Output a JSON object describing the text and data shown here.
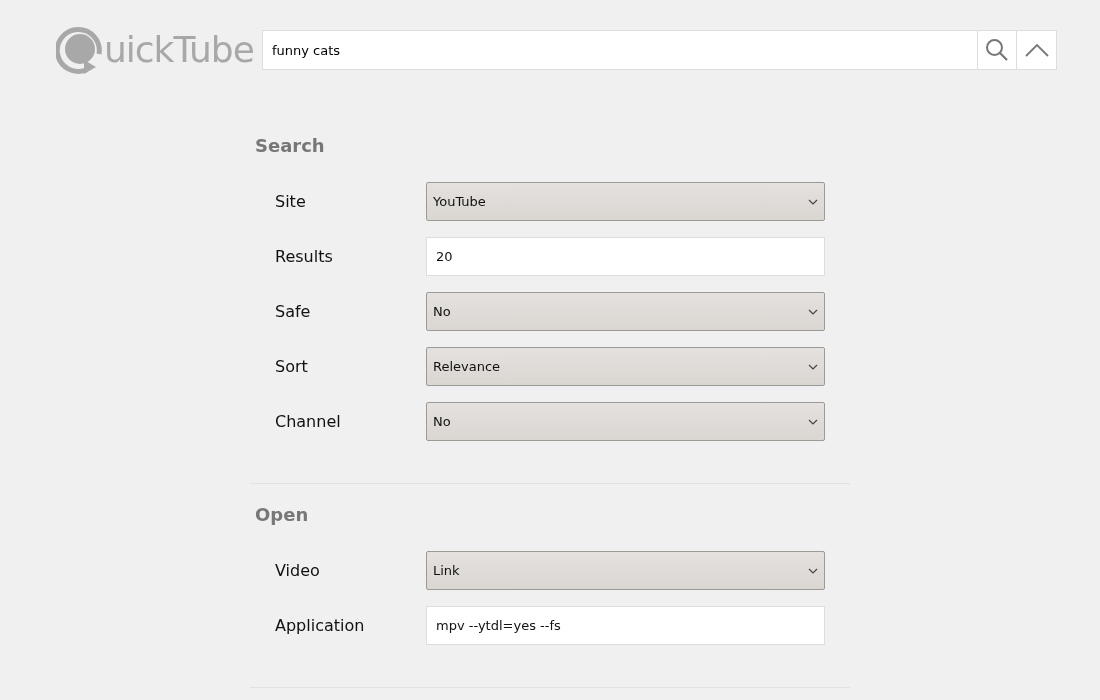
{
  "header": {
    "logo_text": "uickTube",
    "search": {
      "value": "funny cats"
    }
  },
  "sections": [
    {
      "title": "Search",
      "rows": [
        {
          "label": "Site",
          "kind": "select",
          "value": "YouTube"
        },
        {
          "label": "Results",
          "kind": "input",
          "value": "20"
        },
        {
          "label": "Safe",
          "kind": "select",
          "value": "No"
        },
        {
          "label": "Sort",
          "kind": "select",
          "value": "Relevance"
        },
        {
          "label": "Channel",
          "kind": "select",
          "value": "No"
        }
      ]
    },
    {
      "title": "Open",
      "rows": [
        {
          "label": "Video",
          "kind": "select",
          "value": "Link"
        },
        {
          "label": "Application",
          "kind": "input",
          "value": "mpv --ytdl=yes --fs"
        }
      ]
    }
  ]
}
